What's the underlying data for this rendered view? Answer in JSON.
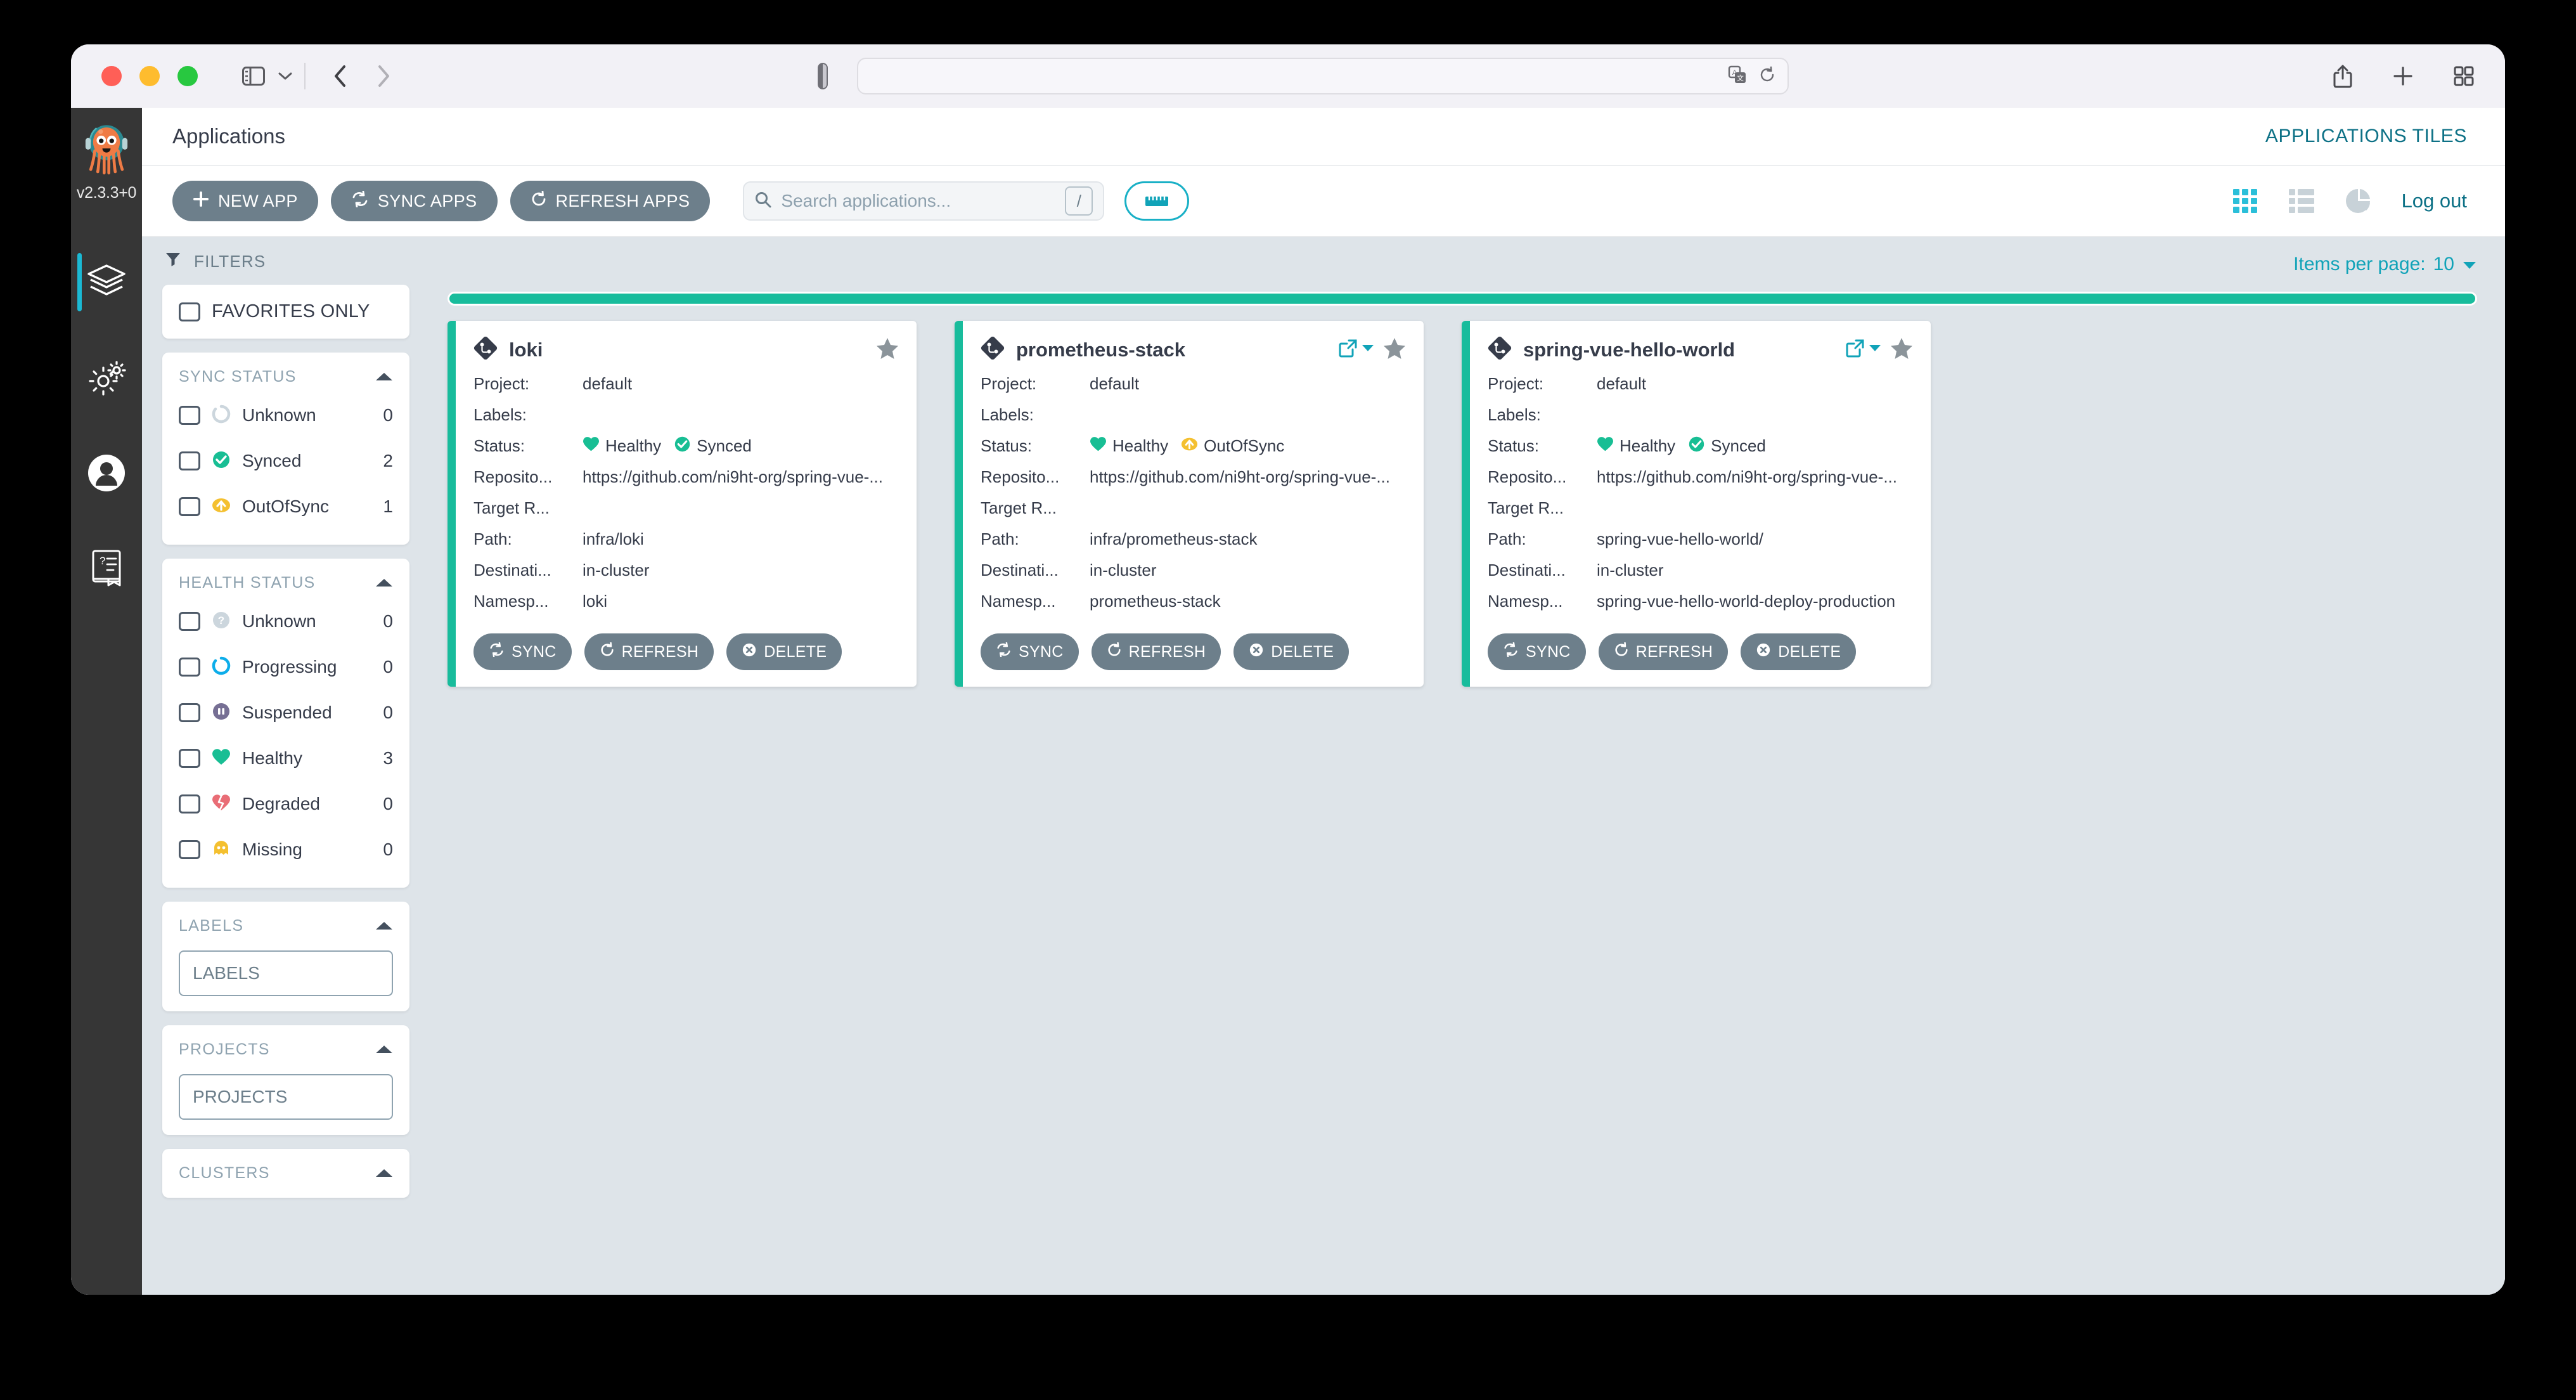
{
  "browser": {
    "address_value": "",
    "address_placeholder": ""
  },
  "argo": {
    "version": "v2.3.3+0",
    "nav": [
      {
        "name": "applications",
        "icon": "layers-icon",
        "active": true
      },
      {
        "name": "settings",
        "icon": "gears-icon",
        "active": false
      },
      {
        "name": "user-info",
        "icon": "user-icon",
        "active": false
      },
      {
        "name": "documentation",
        "icon": "book-help-icon",
        "active": false
      }
    ]
  },
  "header": {
    "breadcrumb": "Applications",
    "right_label": "APPLICATIONS TILES"
  },
  "toolbar": {
    "new_app": "NEW APP",
    "sync_apps": "SYNC APPS",
    "refresh_apps": "REFRESH APPS",
    "search_placeholder": "Search applications...",
    "search_value": "",
    "slash_hint": "/",
    "logout": "Log out"
  },
  "filters": {
    "title": "FILTERS",
    "favorites_only": "FAVORITES ONLY",
    "sync_status": {
      "title": "SYNC STATUS",
      "rows": [
        {
          "label": "Unknown",
          "count": "0",
          "icon": "unknown-circle-icon",
          "color": "#ccd6dd"
        },
        {
          "label": "Synced",
          "count": "2",
          "icon": "synced-check-icon",
          "color": "#18be94"
        },
        {
          "label": "OutOfSync",
          "count": "1",
          "icon": "outofsync-arrow-icon",
          "color": "#f4c030"
        }
      ]
    },
    "health_status": {
      "title": "HEALTH STATUS",
      "rows": [
        {
          "label": "Unknown",
          "count": "0",
          "icon": "question-circle-icon",
          "color": "#ccd6dd"
        },
        {
          "label": "Progressing",
          "count": "0",
          "icon": "progressing-circle-icon",
          "color": "#0dadea"
        },
        {
          "label": "Suspended",
          "count": "0",
          "icon": "pause-circle-icon",
          "color": "#766f94"
        },
        {
          "label": "Healthy",
          "count": "3",
          "icon": "heart-icon",
          "color": "#18be94"
        },
        {
          "label": "Degraded",
          "count": "0",
          "icon": "broken-heart-icon",
          "color": "#e96d76"
        },
        {
          "label": "Missing",
          "count": "0",
          "icon": "ghost-icon",
          "color": "#f4c030"
        }
      ]
    },
    "labels": {
      "title": "LABELS",
      "placeholder": "LABELS",
      "value": ""
    },
    "projects": {
      "title": "PROJECTS",
      "placeholder": "PROJECTS",
      "value": ""
    },
    "clusters": {
      "title": "CLUSTERS"
    }
  },
  "content": {
    "items_per_page_label": "Items per page:",
    "items_per_page_value": "10",
    "progress_percent": 100,
    "row_keys": [
      "Project:",
      "Labels:",
      "Status:",
      "Reposito...",
      "Target R...",
      "Path:",
      "Destinati...",
      "Namesp..."
    ],
    "actions": [
      "SYNC",
      "REFRESH",
      "DELETE"
    ],
    "apps": [
      {
        "name": "loki",
        "favorite": true,
        "has_external_link": false,
        "project": "default",
        "labels": "",
        "health": "Healthy",
        "sync": "Synced",
        "sync_icon": "synced-check-icon",
        "sync_color": "#18be94",
        "repository": "https://github.com/ni9ht-org/spring-vue-...",
        "target_revision": "",
        "path": "infra/loki",
        "destination": "in-cluster",
        "namespace": "loki"
      },
      {
        "name": "prometheus-stack",
        "favorite": true,
        "has_external_link": true,
        "project": "default",
        "labels": "",
        "health": "Healthy",
        "sync": "OutOfSync",
        "sync_icon": "outofsync-arrow-icon",
        "sync_color": "#f4c030",
        "repository": "https://github.com/ni9ht-org/spring-vue-...",
        "target_revision": "",
        "path": "infra/prometheus-stack",
        "destination": "in-cluster",
        "namespace": "prometheus-stack"
      },
      {
        "name": "spring-vue-hello-world",
        "favorite": true,
        "has_external_link": true,
        "project": "default",
        "labels": "",
        "health": "Healthy",
        "sync": "Synced",
        "sync_icon": "synced-check-icon",
        "sync_color": "#18be94",
        "repository": "https://github.com/ni9ht-org/spring-vue-...",
        "target_revision": "",
        "path": "spring-vue-hello-world/",
        "destination": "in-cluster",
        "namespace": "spring-vue-hello-world-deploy-production"
      }
    ]
  },
  "colors": {
    "accent_green": "#18bc9c",
    "accent_teal": "#11a3b8",
    "button_gray": "#6d7f8b",
    "nav_dark": "#363636",
    "page_bg": "#dee4e9"
  }
}
